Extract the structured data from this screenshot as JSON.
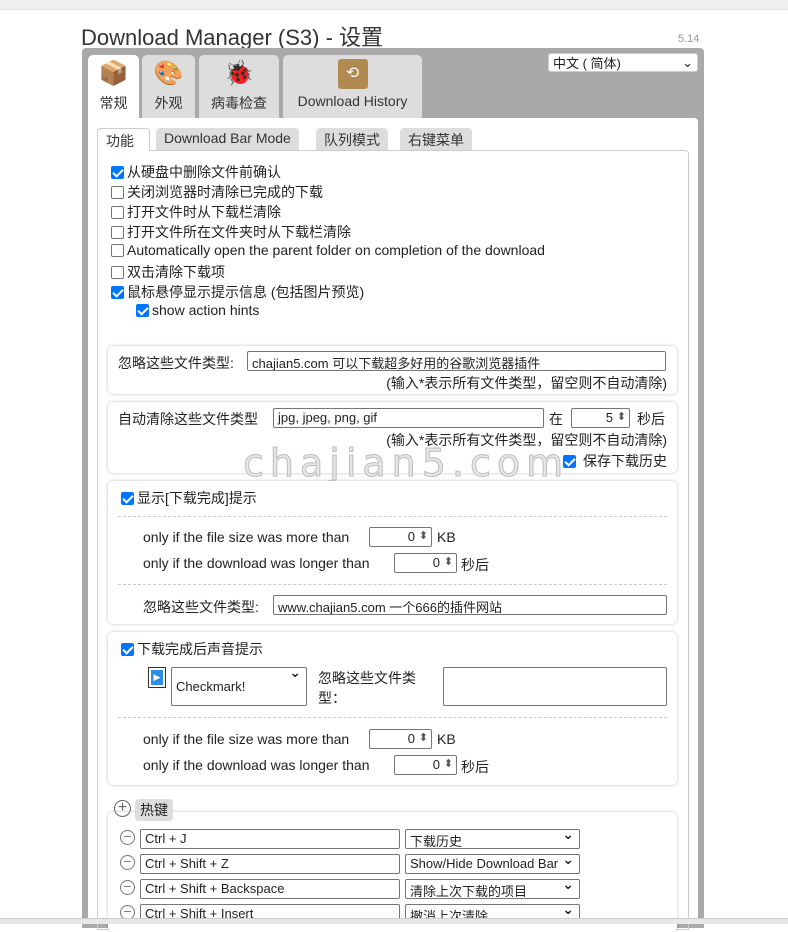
{
  "title": "Download Manager (S3) - 设置",
  "version": "5.14",
  "language": "中文 ( 简体)",
  "main_tabs": [
    {
      "label": "常规",
      "icon": "tools-box-icon"
    },
    {
      "label": "外观",
      "icon": "paint-palette-icon"
    },
    {
      "label": "病毒检查",
      "icon": "bug-icon"
    },
    {
      "label": "Download History",
      "icon": "history-box-icon"
    }
  ],
  "sub_tabs": [
    "功能",
    "Download Bar Mode",
    "队列模式",
    "右键菜单"
  ],
  "options": [
    {
      "label": "从硬盘中删除文件前确认",
      "checked": true
    },
    {
      "label": "关闭浏览器时清除已完成的下载",
      "checked": false
    },
    {
      "label": "打开文件时从下载栏清除",
      "checked": false
    },
    {
      "label": "打开文件所在文件夹时从下载栏清除",
      "checked": false
    },
    {
      "label": "Automatically open the parent folder on completion of the download",
      "checked": false
    },
    {
      "label": "双击清除下载项",
      "checked": false
    },
    {
      "label": "鼠标悬停显示提示信息 (包括图片预览)",
      "checked": true
    },
    {
      "label": "show action hints",
      "checked": true
    }
  ],
  "ignore_box": {
    "label": "忽略这些文件类型:",
    "value": "chajian5.com 可以下载超多好用的谷歌浏览器插件",
    "hint": "(输入*表示所有文件类型，留空则不自动清除)"
  },
  "autoclear_box": {
    "label": "自动清除这些文件类型",
    "value": "jpg, jpeg, png, gif",
    "in": "在",
    "seconds": "5",
    "after": "秒后",
    "hint": "(输入*表示所有文件类型，留空则不自动清除)",
    "save_history": "保存下载历史"
  },
  "watermark": "chajian5.com",
  "notify_box": {
    "label": "显示[下载完成]提示",
    "size_label": "only if the file size was more than",
    "size": "0",
    "size_unit": "KB",
    "time_label": "only if the download was longer than",
    "time": "0",
    "time_unit": "秒后",
    "ignore_label": "忽略这些文件类型:",
    "ignore_value": "www.chajian5.com 一个666的插件网站"
  },
  "sound_box": {
    "label": "下载完成后声音提示",
    "sound": "Checkmark!",
    "ignore_label": "忽略这些文件类型：",
    "ignore_value": "",
    "size_label": "only if the file size was more than",
    "size": "0",
    "size_unit": "KB",
    "time_label": "only if the download was longer than",
    "time": "0",
    "time_unit": "秒后"
  },
  "hotkeys": {
    "label": "热键",
    "rows": [
      {
        "key": "Ctrl + J",
        "action": "下载历史"
      },
      {
        "key": "Ctrl + Shift + Z",
        "action": "Show/Hide Download Bar"
      },
      {
        "key": "Ctrl + Shift + Backspace",
        "action": "清除上次下载的项目"
      },
      {
        "key": "Ctrl + Shift + Insert",
        "action": "撤消上次清除"
      }
    ]
  }
}
